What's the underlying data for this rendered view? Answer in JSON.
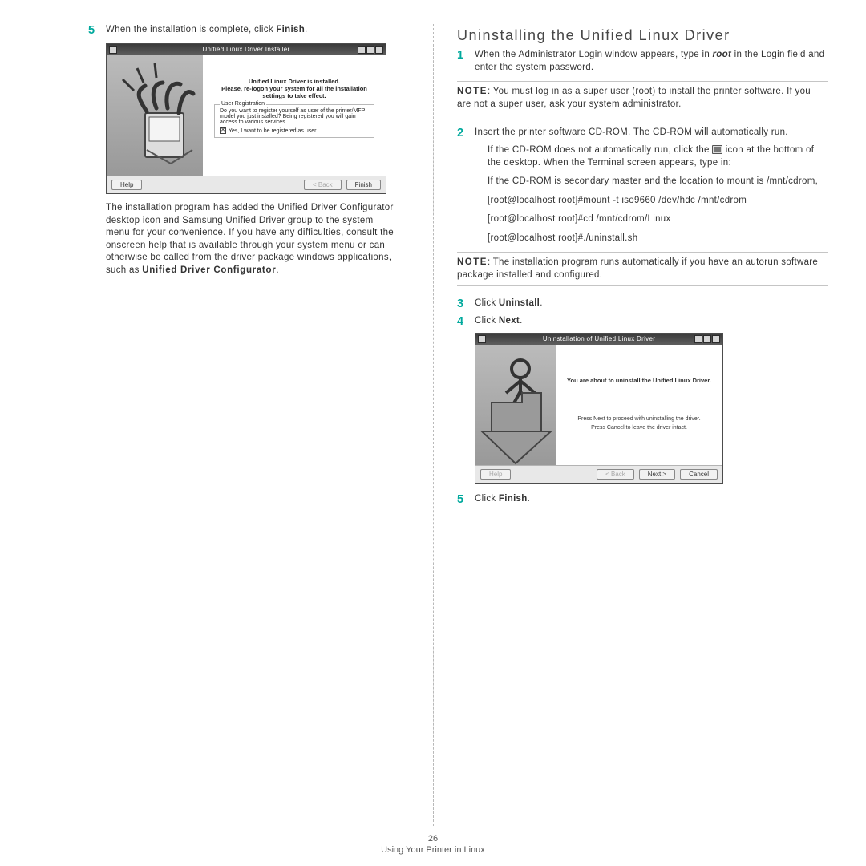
{
  "left": {
    "step5_text_pre": "When the installation is complete, click ",
    "step5_text_bold": "Finish",
    "step5_text_post": ".",
    "dialog1": {
      "title": "Unified Linux Driver Installer",
      "line1": "Unified Linux Driver is installed.",
      "line2": "Please, re-logon your system for all the installation settings to take effect.",
      "reg_legend": "User Registration",
      "reg_text": "Do you want to register yourself as user of the printer/MFP model you just installed? Being registered you will gain access to various services.",
      "reg_check": "Yes, I want to be registered as user",
      "help": "Help",
      "back": "< Back",
      "finish": "Finish"
    },
    "para": "The installation program has added the Unified Driver Configurator desktop icon and Samsung Unified Driver group to the system menu for your convenience. If you have any difficulties, consult the onscreen help that is available through your system menu or can otherwise be called from the driver package windows applications, such as ",
    "para_bold": "Unified Driver Configurator",
    "para_post": "."
  },
  "right": {
    "heading": "Uninstalling the Unified Linux Driver",
    "step1_pre": "When the Administrator Login window appears, type in ",
    "step1_em": "root",
    "step1_post": " in the Login field and enter the system password.",
    "note1_label": "NOTE",
    "note1_text": ": You must log in as a super user (root) to install the printer software. If you are not a super user, ask your system administrator.",
    "step2": "Insert the printer software CD-ROM. The CD-ROM will automatically run.",
    "cd_text1_pre": "If the CD-ROM does not automatically run, click the ",
    "cd_text1_post": " icon at the bottom of the desktop. When the Terminal screen appears, type in:",
    "cd_text2": "If the CD-ROM is secondary master and the location to mount is /mnt/cdrom,",
    "cd_cmd1": "[root@localhost root]#mount -t iso9660 /dev/hdc /mnt/cdrom",
    "cd_cmd2": "[root@localhost root]#cd /mnt/cdrom/Linux",
    "cd_cmd3": "[root@localhost root]#./uninstall.sh",
    "note2_label": "NOTE",
    "note2_text": ": The installation program runs automatically if you have an autorun software package installed and configured.",
    "step3_pre": "Click ",
    "step3_bold": "Uninstall",
    "step3_post": ".",
    "step4_pre": "Click ",
    "step4_bold": "Next",
    "step4_post": ".",
    "dialog2": {
      "title": "Uninstallation of Unified Linux Driver",
      "big": "You are about to uninstall the Unified Linux Driver.",
      "s1": "Press Next to proceed with uninstalling the driver.",
      "s2": "Press Cancel to leave the driver intact.",
      "help": "Help",
      "back": "< Back",
      "next": "Next >",
      "cancel": "Cancel"
    },
    "step5_pre": "Click ",
    "step5_bold": "Finish",
    "step5_post": "."
  },
  "footer": {
    "page": "26",
    "section": "Using Your Printer in Linux"
  }
}
